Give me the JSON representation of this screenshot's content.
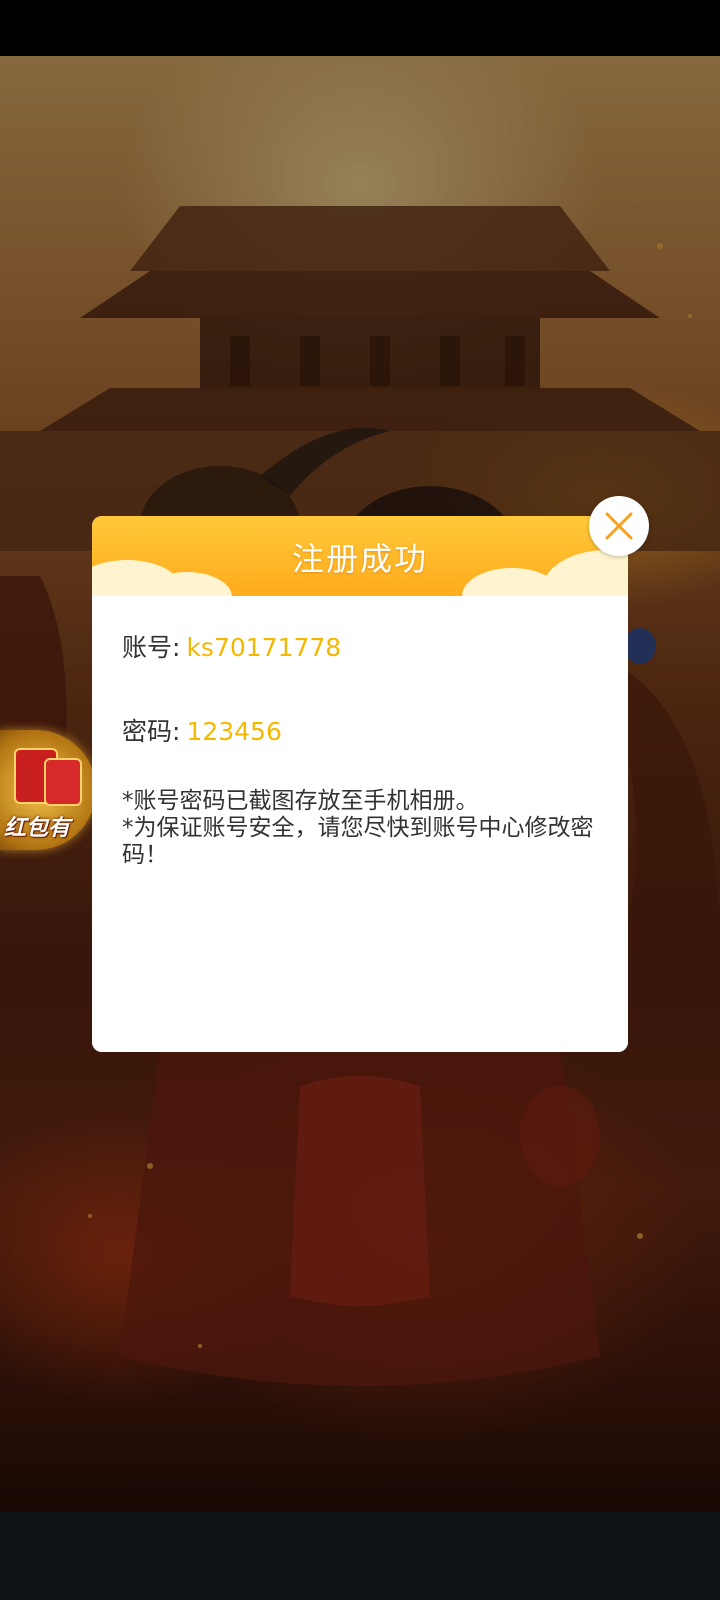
{
  "dialog": {
    "title": "注册成功",
    "account_label": "账号:",
    "account_value": "ks70171778",
    "password_label": "密码:",
    "password_value": "123456",
    "notice_line1": "*账号密码已截图存放至手机相册。",
    "notice_line2": "*为保证账号安全，请您尽快到账号中心修改密码！"
  },
  "background": {
    "red_packet_label": "红包有"
  },
  "colors": {
    "header_top": "#ffc93a",
    "header_bottom": "#ffab1c",
    "value_text": "#f5b800",
    "close_icon": "#f7a21c"
  },
  "icons": {
    "close": "close-icon"
  }
}
